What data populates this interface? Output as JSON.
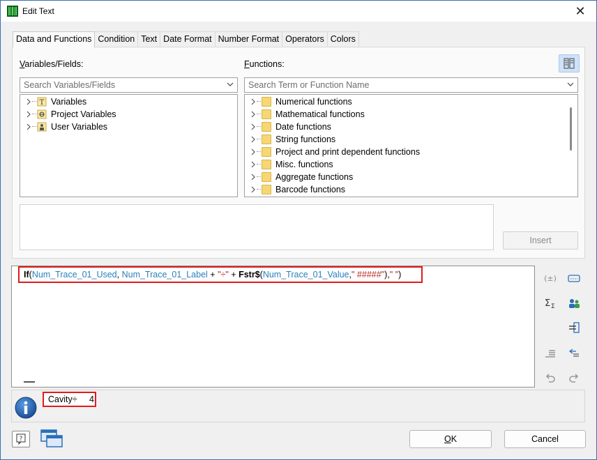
{
  "window": {
    "title": "Edit Text",
    "close_glyph": "✕"
  },
  "tabs": [
    {
      "label": "Data and Functions",
      "active": true
    },
    {
      "label": "Condition"
    },
    {
      "label": "Text"
    },
    {
      "label": "Date Format"
    },
    {
      "label": "Number Format"
    },
    {
      "label": "Operators"
    },
    {
      "label": "Colors"
    }
  ],
  "variables": {
    "label_prefix": "V",
    "label_rest": "ariables/Fields:",
    "search_placeholder": "Search Variables/Fields",
    "items": [
      {
        "label": "Variables",
        "icon": "text-variable-icon"
      },
      {
        "label": "Project Variables",
        "icon": "project-variable-icon"
      },
      {
        "label": "User Variables",
        "icon": "user-variable-icon"
      }
    ]
  },
  "functions": {
    "label_prefix": "F",
    "label_rest": "unctions:",
    "search_placeholder": "Search Term or Function Name",
    "items": [
      {
        "label": "Numerical functions"
      },
      {
        "label": "Mathematical functions"
      },
      {
        "label": "Date functions"
      },
      {
        "label": "String functions"
      },
      {
        "label": "Project and print dependent functions"
      },
      {
        "label": "Misc. functions"
      },
      {
        "label": "Aggregate functions"
      },
      {
        "label": "Barcode functions"
      }
    ]
  },
  "insert_label": "Insert",
  "formula": {
    "t1": "If",
    "t2": "(",
    "t3": "Num_Trace_01_Used",
    "t4": ", ",
    "t5": "Num_Trace_01_Label",
    "t6": " + ",
    "t7": "\"÷\"",
    "t8": " + ",
    "t9": "Fstr$",
    "t10": "(",
    "t11": "Num_Trace_01_Value",
    "t12": ",",
    "t13": "\" #####\"",
    "t14": "),",
    "t15": "\" \"",
    "t16": ")"
  },
  "result": {
    "value": "Cavity÷     4"
  },
  "buttons": {
    "ok_prefix": "",
    "ok_u": "O",
    "ok_rest": "K",
    "cancel": "Cancel"
  },
  "colors": {
    "highlight_border": "#e01b1b",
    "field_blue": "#2a7fb8",
    "string_red": "#b3261e",
    "toggle_bg": "#cfe2f7"
  }
}
